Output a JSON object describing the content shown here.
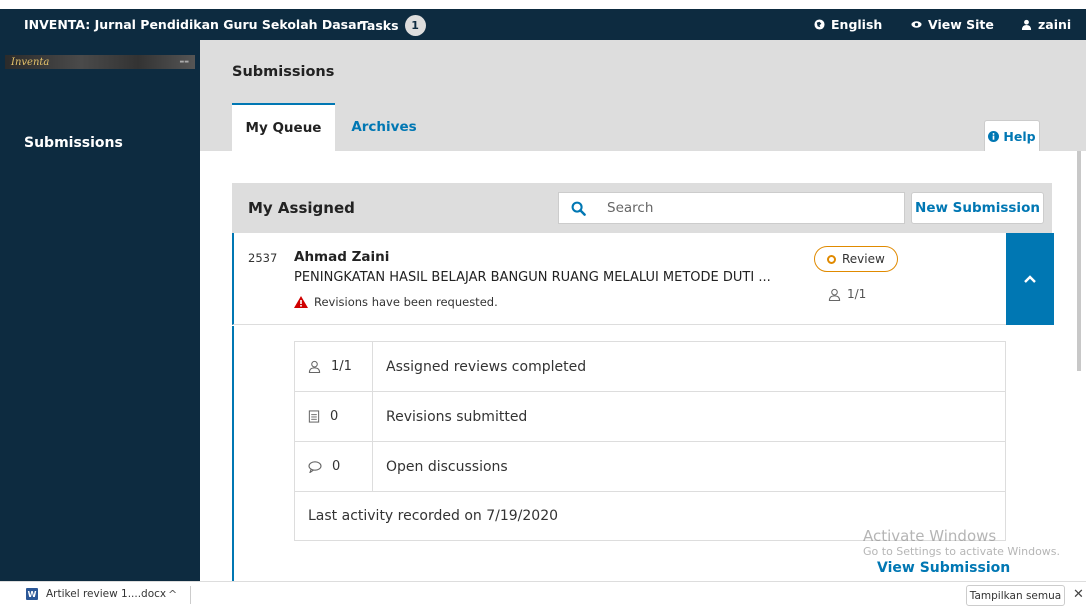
{
  "header": {
    "site_title": "INVENTA: Jurnal Pendidikan Guru Sekolah Dasar",
    "tasks_label": "Tasks",
    "tasks_count": "1",
    "language": "English",
    "view_site": "View Site",
    "user": "zaini"
  },
  "sidebar": {
    "logo_text": "Inventa",
    "items": [
      {
        "label": "Submissions"
      }
    ]
  },
  "main": {
    "page_title": "Submissions",
    "tabs": [
      {
        "label": "My Queue",
        "active": true
      },
      {
        "label": "Archives",
        "active": false
      }
    ],
    "help_label": "Help"
  },
  "list": {
    "title": "My Assigned",
    "search_placeholder": "Search",
    "new_submission_label": "New Submission"
  },
  "submission": {
    "id": "2537",
    "author": "Ahmad Zaini",
    "title": "PENINGKATAN HASIL BELAJAR BANGUN RUANG MELALUI METODE DUTI ...",
    "notice": "Revisions have been requested.",
    "stage": "Review",
    "reviews": "1/1",
    "stats": [
      {
        "icon": "user-icon",
        "value": "1/1",
        "label": "Assigned reviews completed"
      },
      {
        "icon": "document-icon",
        "value": "0",
        "label": "Revisions submitted"
      },
      {
        "icon": "comment-icon",
        "value": "0",
        "label": "Open discussions"
      }
    ],
    "last_activity": "Last activity recorded on 7/19/2020",
    "view_label": "View Submission"
  },
  "watermark": {
    "line1": "Activate Windows",
    "line2": "Go to Settings to activate Windows."
  },
  "download_bar": {
    "file_name": "Artikel review 1....docx",
    "show_all": "Tampilkan semua"
  },
  "colors": {
    "header_bg": "#0d2b40",
    "accent": "#0077b3",
    "stage_badge": "#e08a00",
    "warning": "#d00000"
  }
}
